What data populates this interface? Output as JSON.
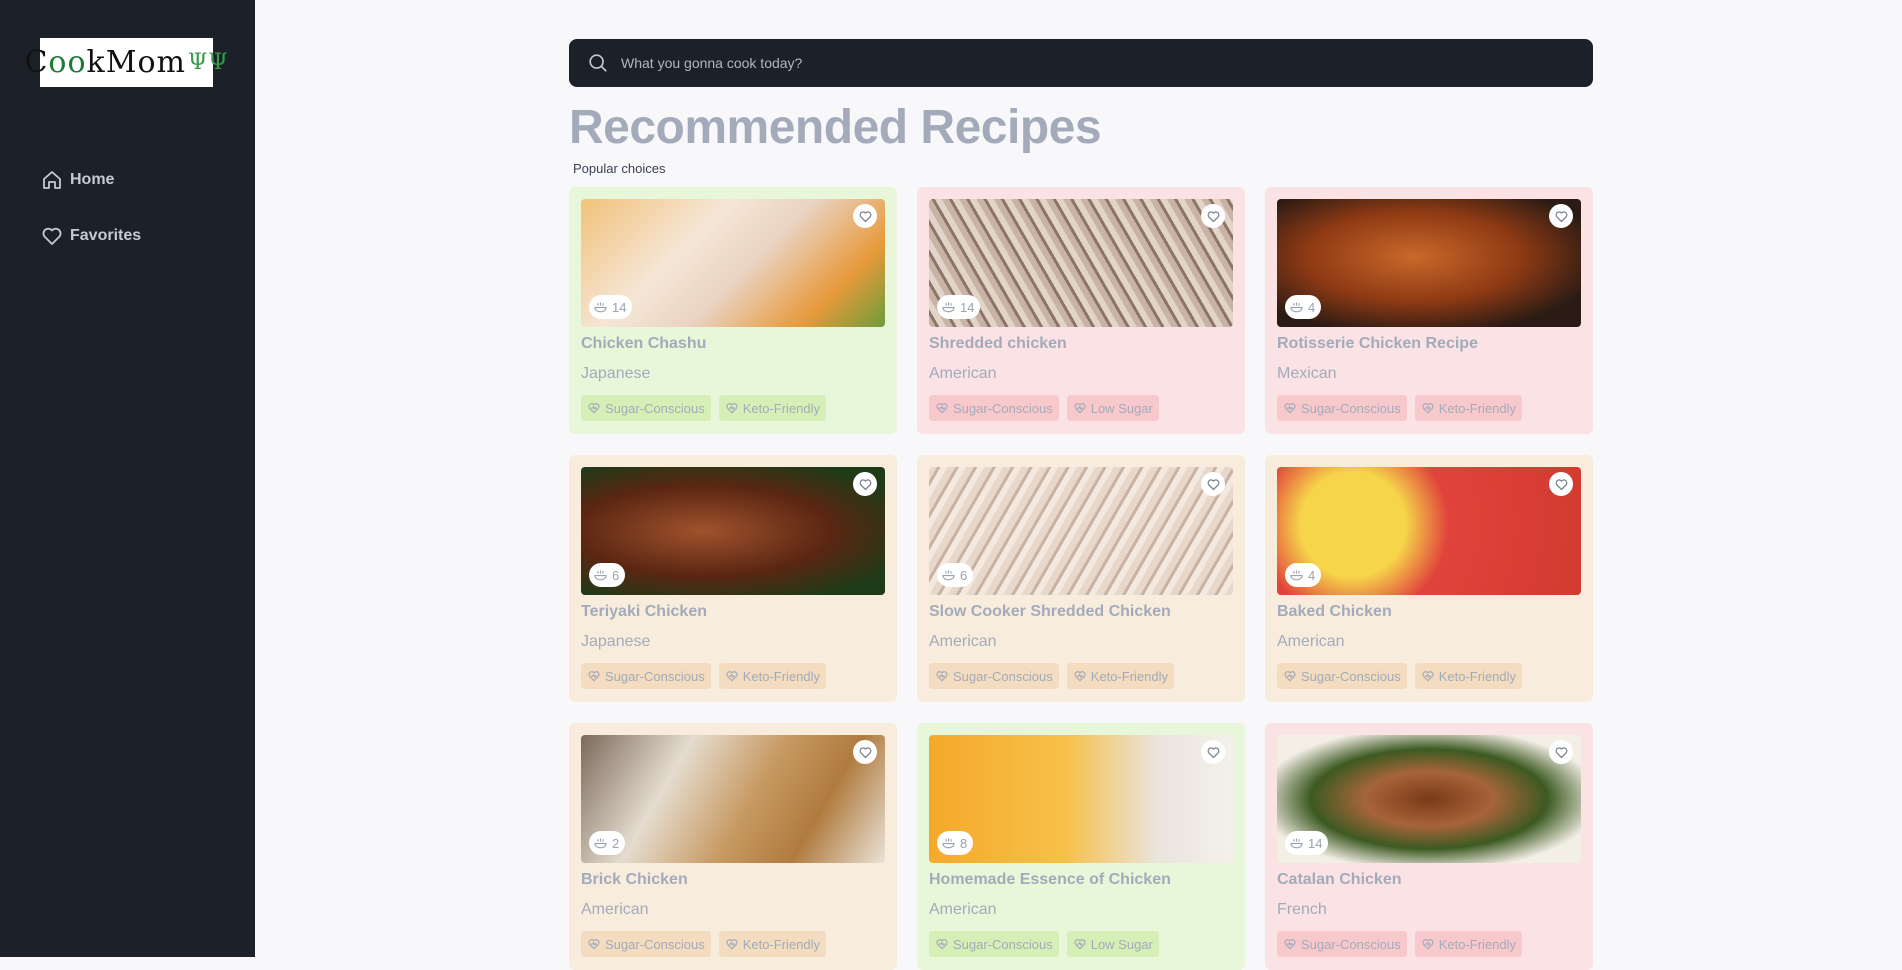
{
  "sidebar": {
    "logo_text": "CookMom",
    "items": [
      {
        "label": "Home",
        "icon": "home-icon"
      },
      {
        "label": "Favorites",
        "icon": "heart-icon"
      }
    ]
  },
  "search": {
    "placeholder": "What you gonna cook today?"
  },
  "header": {
    "title": "Recommended Recipes",
    "subtitle": "Popular choices"
  },
  "recipes": [
    {
      "name": "Chicken Chashu",
      "cuisine": "Japanese",
      "servings": "14",
      "tags": [
        "Sugar-Conscious",
        "Keto-Friendly"
      ],
      "color": "green"
    },
    {
      "name": "Shredded chicken",
      "cuisine": "American",
      "servings": "14",
      "tags": [
        "Sugar-Conscious",
        "Low Sugar"
      ],
      "color": "pink"
    },
    {
      "name": "Rotisserie Chicken Recipe",
      "cuisine": "Mexican",
      "servings": "4",
      "tags": [
        "Sugar-Conscious",
        "Keto-Friendly"
      ],
      "color": "pink"
    },
    {
      "name": "Teriyaki Chicken",
      "cuisine": "Japanese",
      "servings": "6",
      "tags": [
        "Sugar-Conscious",
        "Keto-Friendly"
      ],
      "color": "orange"
    },
    {
      "name": "Slow Cooker Shredded Chicken",
      "cuisine": "American",
      "servings": "6",
      "tags": [
        "Sugar-Conscious",
        "Keto-Friendly"
      ],
      "color": "orange"
    },
    {
      "name": "Baked Chicken",
      "cuisine": "American",
      "servings": "4",
      "tags": [
        "Sugar-Conscious",
        "Keto-Friendly"
      ],
      "color": "orange"
    },
    {
      "name": "Brick Chicken",
      "cuisine": "American",
      "servings": "2",
      "tags": [
        "Sugar-Conscious",
        "Keto-Friendly"
      ],
      "color": "orange"
    },
    {
      "name": "Homemade Essence of Chicken",
      "cuisine": "American",
      "servings": "8",
      "tags": [
        "Sugar-Conscious",
        "Low Sugar"
      ],
      "color": "green"
    },
    {
      "name": "Catalan Chicken",
      "cuisine": "French",
      "servings": "14",
      "tags": [
        "Sugar-Conscious",
        "Keto-Friendly"
      ],
      "color": "pink"
    }
  ],
  "colors": {
    "sidebar": "#1c2129",
    "accent_green": "#e8f6d9",
    "accent_pink": "#fbe2e4",
    "accent_orange": "#f8ecdd",
    "text_muted": "#a3abba"
  }
}
